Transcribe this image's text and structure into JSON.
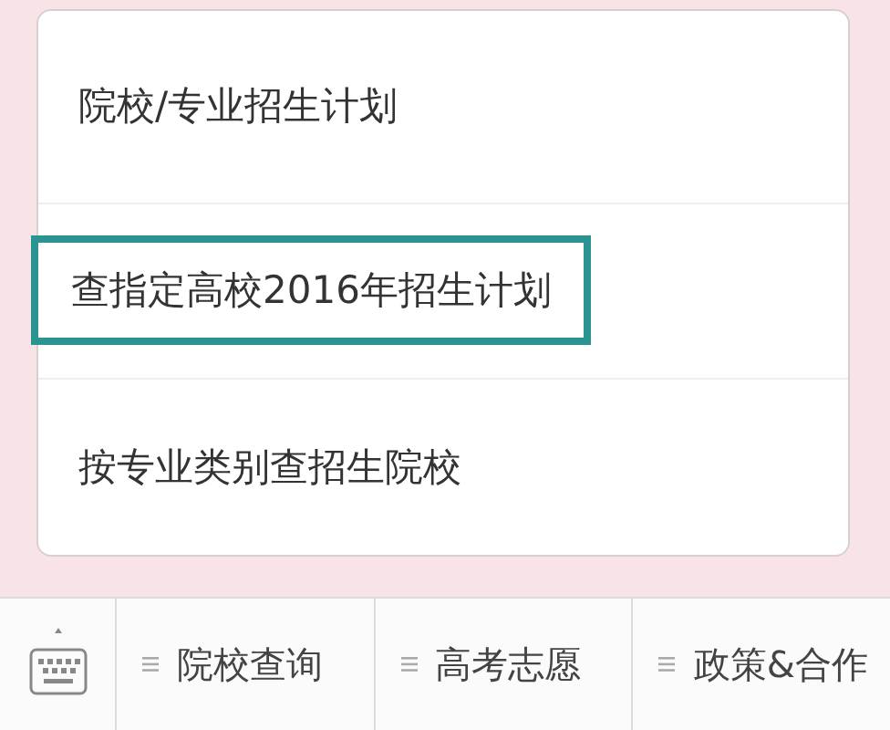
{
  "menu": {
    "items": [
      {
        "label": "院校/专业招生计划",
        "selected": false
      },
      {
        "label": "查指定高校2016年招生计划",
        "selected": true
      },
      {
        "label": "按专业类别查招生院校",
        "selected": false
      }
    ]
  },
  "bottom_bar": {
    "tabs": [
      {
        "label": "院校查询"
      },
      {
        "label": "高考志愿"
      },
      {
        "label": "政策&合作"
      }
    ]
  }
}
